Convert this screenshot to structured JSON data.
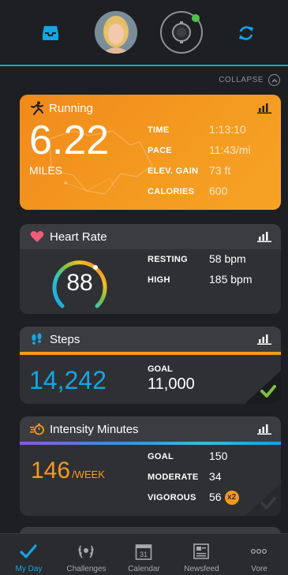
{
  "header": {
    "inbox_icon": "inbox-icon",
    "avatar_alt": "profile-photo",
    "device_icon": "watch-icon",
    "sync_icon": "sync-icon",
    "accent": "#11a6e8",
    "device_status_color": "#4cc24a"
  },
  "collapse": {
    "label": "COLLAPSE"
  },
  "running": {
    "title": "Running",
    "value": "6.22",
    "unit": "MILES",
    "stats": [
      {
        "label": "TIME",
        "value": "1:13:10"
      },
      {
        "label": "PACE",
        "value": "11:43/mi"
      },
      {
        "label": "ELEV. GAIN",
        "value": "73 ft"
      },
      {
        "label": "CALORIES",
        "value": "600"
      }
    ],
    "color": "#f49a20"
  },
  "heart_rate": {
    "title": "Heart Rate",
    "value": "88",
    "stats": [
      {
        "label": "RESTING",
        "value": "58 bpm"
      },
      {
        "label": "HIGH",
        "value": "185 bpm"
      }
    ],
    "icon_color": "#f45b7a"
  },
  "steps": {
    "title": "Steps",
    "value": "14,242",
    "goal_label": "GOAL",
    "goal_value": "11,000",
    "value_color": "#12a6e6",
    "check_color": "#7bc043"
  },
  "intensity": {
    "title": "Intensity Minutes",
    "value": "146",
    "unit": "/WEEK",
    "stats": [
      {
        "label": "GOAL",
        "value": "150"
      },
      {
        "label": "MODERATE",
        "value": "34"
      },
      {
        "label": "VIGOROUS",
        "value": "56"
      }
    ],
    "multiplier": "x2",
    "value_color": "#f49a20"
  },
  "nav": {
    "items": [
      {
        "label": "My Day",
        "icon": "check-icon",
        "active": true
      },
      {
        "label": "Challenges",
        "icon": "laurel-icon",
        "active": false
      },
      {
        "label": "Calendar",
        "icon": "calendar-icon",
        "active": false,
        "day": "31"
      },
      {
        "label": "Newsfeed",
        "icon": "newsfeed-icon",
        "active": false
      },
      {
        "label": "Vore",
        "icon": "more-icon",
        "active": false
      }
    ]
  }
}
